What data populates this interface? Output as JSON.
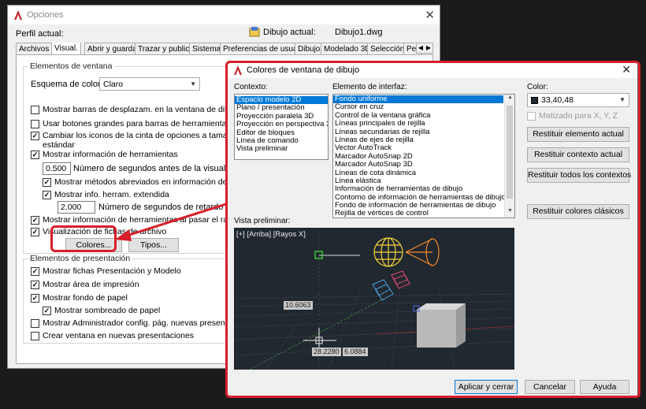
{
  "opciones": {
    "title": "Opciones",
    "profile_label": "Perfil actual:",
    "drawing_label": "Dibujo actual:",
    "drawing_value": "Dibujo1.dwg",
    "tabs": [
      "Archivos",
      "Visual.",
      "Abrir y guardar",
      "Trazar y publicar",
      "Sistema",
      "Preferencias de usuario",
      "Dibujo",
      "Modelado 3D",
      "Selección",
      "Per"
    ],
    "window_elements": {
      "title": "Elementos de ventana",
      "color_scheme_label": "Esquema de color:",
      "color_scheme_value": "Claro",
      "show_scrollbars": "Mostrar barras de desplazam. en la ventana de dibujo",
      "large_buttons": "Usar botones grandes para barras de herramientas",
      "resize_ribbon_icons_1": "Cambiar los iconos de la cinta de opciones a tamaño",
      "resize_ribbon_icons_2": "estándar",
      "show_tooltips": "Mostrar información de herramientas",
      "delay_seconds_value": "0.500",
      "delay_seconds_label": "Número de segundos antes de la visualización",
      "show_shortcuts": "Mostrar métodos abreviados en información de herram.",
      "show_extended": "Mostrar info. herram. extendida",
      "extended_delay_value": "2.000",
      "extended_delay_label": "Número de segundos de retardo",
      "rollover_tooltips": "Mostrar información de herramientas al pasar el ratón",
      "file_tabs": "Visualización de fichas de archivo",
      "colors_button": "Colores...",
      "fonts_button": "Tipos..."
    },
    "layout_elements": {
      "title": "Elementos de presentación",
      "layout_tabs": "Mostrar fichas Presentación y Modelo",
      "printable_area": "Mostrar área de impresión",
      "paper_background": "Mostrar fondo de papel",
      "paper_shadow": "Mostrar sombreado de papel",
      "page_setup_manager": "Mostrar Administrador config. pág. nuevas present.",
      "create_viewport": "Crear ventana en nuevas presentaciones"
    }
  },
  "colores": {
    "title": "Colores de ventana de dibujo",
    "context_label": "Contexto:",
    "contexts": [
      "Espacio modelo 2D",
      "Plano / presentación",
      "Proyección paralela 3D",
      "Proyección en perspectiva 3D",
      "Editor de bloques",
      "Línea de comando",
      "Vista preliminar"
    ],
    "interface_label": "Elemento de interfaz:",
    "interface_elements": [
      "Fondo uniforme",
      "Cursor en cruz",
      "Control de la ventana gráfica",
      "Líneas principales de rejilla",
      "Líneas secundarias de rejilla",
      "Líneas de ejes de rejilla",
      "Vector AutoTrack",
      "Marcador AutoSnap 2D",
      "Marcador AutoSnap 3D",
      "Líneas de cota dinámica",
      "Línea elástica",
      "Información de herramientas de dibujo",
      "Contorno de información de herramientas de dibujo",
      "Fondo de información de herramientas de dibujo",
      "Rejilla de vértices de control"
    ],
    "color_label": "Color:",
    "color_value": "33,40,48",
    "color_hex": "#212830",
    "tint_label": "Matizado para X, Y, Z",
    "restore_element": "Restituir elemento actual",
    "restore_context": "Restituir contexto actual",
    "restore_all": "Restituir todos los contextos",
    "restore_classic": "Restituir colores clásicos",
    "preview_label": "Vista preliminar:",
    "viewport_label": "[+] [Arriba] [Rayos X]",
    "dim_value": "10.6063",
    "coord_x": "28.2280",
    "coord_y": "6.0884",
    "apply_button": "Aplicar y cerrar",
    "cancel_button": "Cancelar",
    "help_button": "Ayuda"
  },
  "highlight_color": "#d81e2a"
}
